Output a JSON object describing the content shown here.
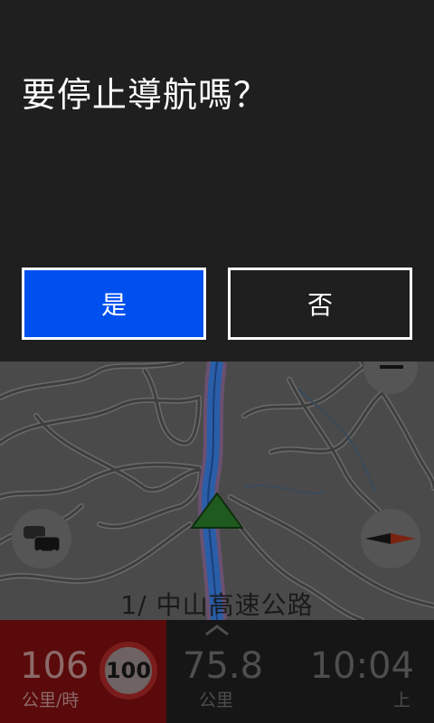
{
  "dialog": {
    "title": "要停止導航嗎？",
    "yes_label": "是",
    "no_label": "否"
  },
  "map": {
    "street_name": "1/ 中山高速公路"
  },
  "status": {
    "speed": "106",
    "speed_unit": "公里/時",
    "speed_limit": "100",
    "distance": "75.8",
    "distance_unit": "公里",
    "time": "10:04",
    "time_unit": "上"
  },
  "icons": {
    "traffic": "traffic-icon",
    "compass": "compass-icon",
    "position": "position-arrow-icon",
    "expand": "chevron-up-icon"
  },
  "colors": {
    "accent": "#0050ef",
    "route": "#2a5ea8",
    "dialog_bg": "#1f1f1f"
  }
}
